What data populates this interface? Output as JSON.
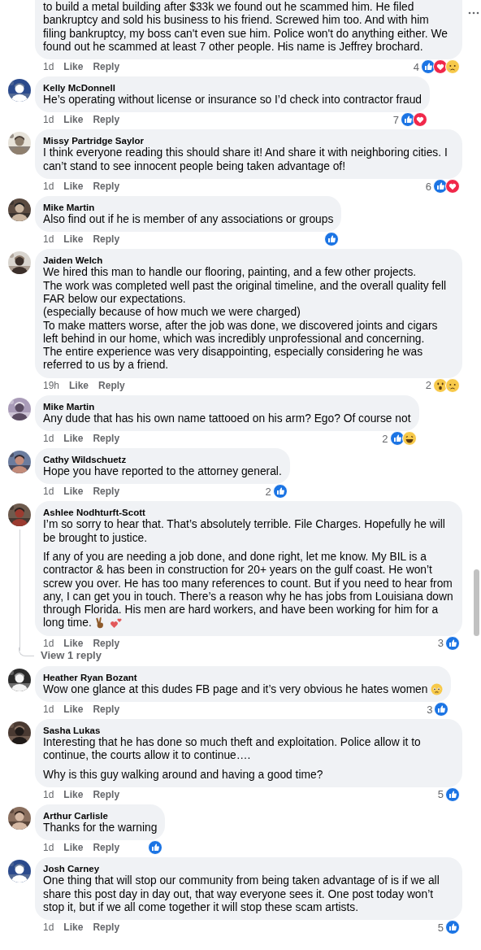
{
  "comments": [
    {
      "paragraphs": [
        "to build a metal building after $33k we found out he scammed him. He filed bankruptcy and sold his business to his friend. Screwed him too. And with him filing bankruptcy, my boss can't even sue him. Police won't do anything either. We found out he scammed at least 7 other people. His name is Jeffrey brochard."
      ],
      "cut_top": true,
      "time": "1d",
      "actions": [
        "Like",
        "Reply"
      ],
      "reactions": {
        "count": "4",
        "icons": [
          {
            "kind": "like"
          },
          {
            "kind": "love"
          },
          {
            "kind": "sad"
          }
        ]
      }
    },
    {
      "author": "Kelly McDonnell",
      "paragraphs": [
        "He’s operating without license or insurance so I’d check into contractor fraud"
      ],
      "time": "1d",
      "actions": [
        "Like",
        "Reply"
      ],
      "reactions": {
        "count": "7",
        "icons": [
          {
            "kind": "like"
          },
          {
            "kind": "love"
          }
        ]
      }
    },
    {
      "author": "Missy Partridge Saylor",
      "paragraphs": [
        "I think everyone reading this should share it! And share it with neighboring cities. I can’t stand to see innocent people being taken advantage of!"
      ],
      "time": "1d",
      "actions": [
        "Like",
        "Reply"
      ],
      "reactions": {
        "count": "6",
        "icons": [
          {
            "kind": "like"
          },
          {
            "kind": "love"
          }
        ]
      }
    },
    {
      "author": "Mike Martin",
      "paragraphs": [
        "Also find out if he is member of any associations or groups"
      ],
      "time": "1d",
      "actions": [
        "Like",
        "Reply"
      ],
      "reactions": {
        "icons": [
          {
            "kind": "like"
          }
        ]
      }
    },
    {
      "author": "Jaiden Welch",
      "paragraphs": [
        "We hired this man to handle our flooring, painting, and a few other projects.\nThe work was completed well past the original timeline, and the overall quality fell FAR below our expectations.\n(especially because of how much we were charged)\nTo make matters worse, after the job was done, we discovered joints and cigars left behind in our home, which was incredibly unprofessional and concerning.\nThe entire experience was very disappointing, especially considering he was referred to us by a friend."
      ],
      "time": "19h",
      "actions": [
        "Like",
        "Reply"
      ],
      "reactions": {
        "count": "2",
        "icons": [
          {
            "kind": "wow"
          },
          {
            "kind": "sad"
          }
        ]
      }
    },
    {
      "author": "Mike Martin",
      "paragraphs": [
        "Any dude that has his own name tattooed on his arm? Ego? Of course not"
      ],
      "time": "1d",
      "actions": [
        "Like",
        "Reply"
      ],
      "reactions": {
        "count": "2",
        "icons": [
          {
            "kind": "like"
          },
          {
            "kind": "haha"
          }
        ]
      }
    },
    {
      "author": "Cathy Wildschuetz",
      "paragraphs": [
        "Hope you have reported to the attorney general."
      ],
      "time": "1d",
      "actions": [
        "Like",
        "Reply"
      ],
      "reactions": {
        "count": "2",
        "icons": [
          {
            "kind": "like"
          }
        ]
      }
    },
    {
      "author": "Ashlee Nodhturft-Scott",
      "paragraphs": [
        "I’m so sorry to hear that. That’s absolutely terrible. File Charges. Hopefully he will be brought to justice.",
        "If any of you are needing a job done, and done right, let me know. My BIL is a contractor & has been in construction for 20+ years on the gulf coast. He won’t screw you over. He has too many references to count. But if you need to hear from any, I can get you in touch. There’s a reason why he has jobs from Louisiana down through Florida. His men are hard workers, and have been working for him for a long time."
      ],
      "emoji_icons": [
        {
          "kind": "peace-hand"
        },
        {
          "kind": "two-hearts"
        }
      ],
      "time": "1d",
      "actions": [
        "Like",
        "Reply"
      ],
      "reactions": {
        "count": "3",
        "icons": [
          {
            "kind": "like"
          }
        ]
      },
      "replies_link": "View 1 reply"
    },
    {
      "author": "Heather Ryan Bozant",
      "paragraphs": [
        "Wow one glance at this dudes FB page and it’s very obvious he hates women"
      ],
      "emoji_icons": [
        {
          "kind": "flushed-face"
        }
      ],
      "time": "1d",
      "actions": [
        "Like",
        "Reply"
      ],
      "reactions": {
        "count": "3",
        "icons": [
          {
            "kind": "like"
          }
        ]
      }
    },
    {
      "author": "Sasha Lukas",
      "paragraphs": [
        "Interesting that he has done so much theft and exploitation. Police allow it to continue, the courts allow it to continue….",
        "Why is this guy walking around and having a good time?"
      ],
      "time": "1d",
      "actions": [
        "Like",
        "Reply"
      ],
      "reactions": {
        "count": "5",
        "icons": [
          {
            "kind": "like"
          }
        ]
      }
    },
    {
      "author": "Arthur Carlisle",
      "paragraphs": [
        "Thanks for the warning"
      ],
      "time": "1d",
      "actions": [
        "Like",
        "Reply"
      ],
      "reactions": {
        "icons": [
          {
            "kind": "like"
          }
        ]
      }
    },
    {
      "author": "Josh Carney",
      "paragraphs": [
        "One thing that will stop our community from being taken advantage of is if we all share this post day in day out, that way everyone sees it. One post today won’t stop it, but if we all come together it will stop these scam artists."
      ],
      "time": "1d",
      "actions": [
        "Like",
        "Reply"
      ],
      "reactions": {
        "count": "5",
        "icons": [
          {
            "kind": "like"
          }
        ]
      }
    }
  ]
}
